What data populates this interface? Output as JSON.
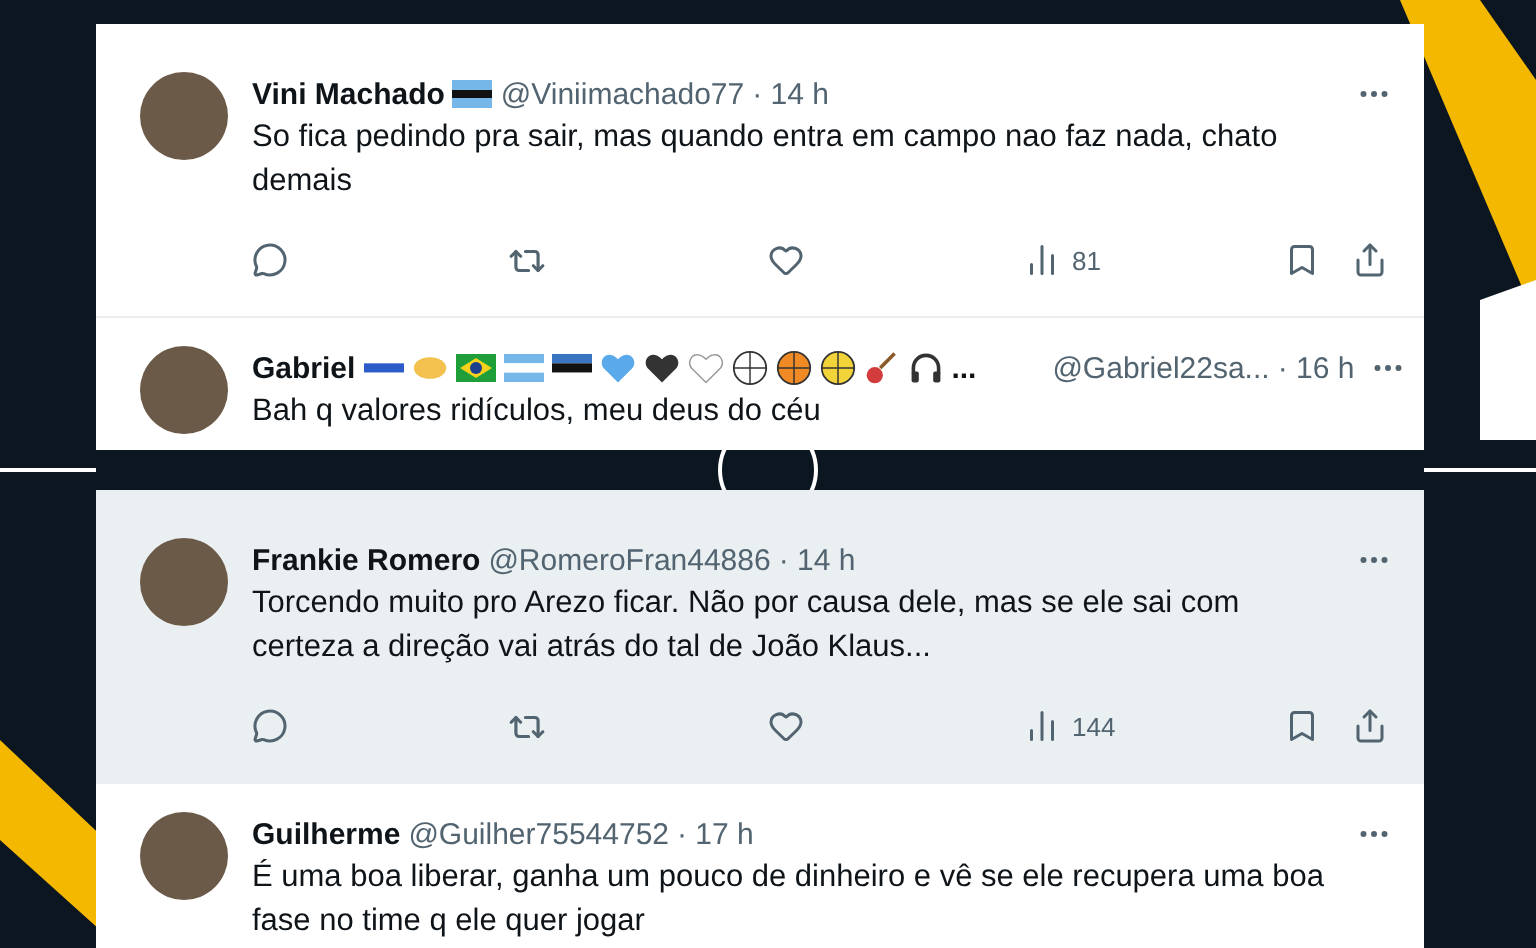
{
  "cards": [
    {
      "tweets": [
        {
          "name": "Vini Machado",
          "name_flag": true,
          "handle": "@Viniimachado77",
          "time": "· 14 h",
          "text": "So fica pedindo pra sair, mas quando entra em campo nao faz nada, chato demais",
          "views": "81",
          "hovered": false
        },
        {
          "name": "Gabriel",
          "emoji_more": "...",
          "handle": "@Gabriel22sa...",
          "time": "· 16 h",
          "text": "Bah q valores ridículos, meu deus do céu",
          "hovered": false
        }
      ]
    },
    {
      "tweets": [
        {
          "name": "Frankie Romero",
          "handle": "@RomeroFran44886",
          "time": "· 14 h",
          "text": "Torcendo muito pro Arezo ficar. Não por causa dele, mas se ele sai com certeza a direção vai atrás do tal de João Klaus...",
          "views": "144",
          "hovered": true
        },
        {
          "name": "Guilherme",
          "handle": "@Guilher75544752",
          "time": "· 17 h",
          "text": "É uma boa liberar, ganha um pouco de dinheiro e vê se ele recupera uma boa fase no time q ele quer jogar",
          "hovered": false
        }
      ]
    }
  ]
}
